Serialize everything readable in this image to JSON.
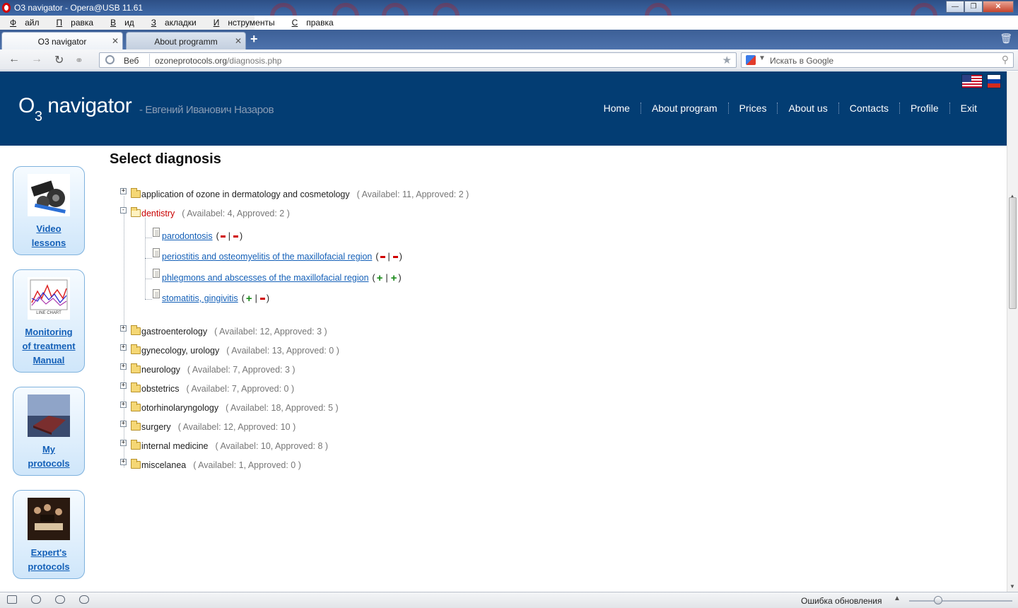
{
  "window": {
    "title": "O3 navigator - Opera@USB 11.61"
  },
  "menubar": {
    "items": [
      {
        "accel": "Ф",
        "rest": "айл"
      },
      {
        "accel": "П",
        "rest": "равка"
      },
      {
        "accel": "В",
        "rest": "ид"
      },
      {
        "accel": "З",
        "rest": "акладки"
      },
      {
        "accel": "И",
        "rest": "нструменты"
      },
      {
        "accel": "С",
        "rest": "правка"
      }
    ]
  },
  "tabs": [
    {
      "label": "O3 navigator",
      "active": true
    },
    {
      "label": "About programm",
      "active": false
    }
  ],
  "addressbar": {
    "scheme_label": "Веб",
    "url_host": "ozoneprotocols.org",
    "url_path": "/diagnosis.php",
    "search_placeholder": "Искать в Google"
  },
  "site": {
    "logo_text": "O",
    "logo_sub": "3",
    "logo_word": " navigator",
    "tagline": "- Евгений Иванович Назаров",
    "nav": [
      "Home",
      "About program",
      "Prices",
      "About us",
      "Contacts",
      "Profile",
      "Exit"
    ]
  },
  "sidebar": {
    "cards": [
      {
        "label_lines": [
          "Video",
          "lessons"
        ],
        "icon": "film-reel-icon"
      },
      {
        "label_lines": [
          "Monitoring",
          "of treatment",
          "Manual"
        ],
        "icon": "line-chart-icon",
        "thumb_caption": "LINE CHART"
      },
      {
        "label_lines": [
          "My",
          "protocols"
        ],
        "icon": "book-icon"
      },
      {
        "label_lines": [
          "Expert's",
          "protocols"
        ],
        "icon": "painting-icon"
      }
    ]
  },
  "main": {
    "title": "Select diagnosis",
    "categories": [
      {
        "name": "application of ozone in dermatology and cosmetology",
        "counts": "( Availabel: 11, Approved: 2 )",
        "open": false
      },
      {
        "name": "dentistry",
        "counts": "( Availabel: 4, Approved: 2 )",
        "open": true,
        "children": [
          {
            "name": "parodontosis",
            "marks": [
              "minus",
              "minus"
            ]
          },
          {
            "name": "periostitis and osteomyelitis of the maxillofacial region",
            "marks": [
              "minus",
              "minus"
            ]
          },
          {
            "name": "phlegmons and abscesses of the maxillofacial region",
            "marks": [
              "plus",
              "plus"
            ]
          },
          {
            "name": "stomatitis, gingivitis",
            "marks": [
              "plus",
              "minus"
            ]
          }
        ]
      },
      {
        "name": "gastroenterology",
        "counts": "( Availabel: 12, Approved: 3 )",
        "open": false
      },
      {
        "name": "gynecology, urology",
        "counts": "( Availabel: 13, Approved: 0 )",
        "open": false
      },
      {
        "name": "neurology",
        "counts": "( Availabel: 7, Approved: 3 )",
        "open": false
      },
      {
        "name": "obstetrics",
        "counts": "( Availabel: 7, Approved: 0 )",
        "open": false
      },
      {
        "name": "otorhinolaryngology",
        "counts": "( Availabel: 18, Approved: 5 )",
        "open": false
      },
      {
        "name": "surgery",
        "counts": "( Availabel: 12, Approved: 10 )",
        "open": false
      },
      {
        "name": "internal medicine",
        "counts": "( Availabel: 10, Approved: 8 )",
        "open": false
      },
      {
        "name": "miscelanea",
        "counts": "( Availabel: 1, Approved: 0 )",
        "open": false
      }
    ]
  },
  "statusbar": {
    "text": "Ошибка обновления"
  }
}
